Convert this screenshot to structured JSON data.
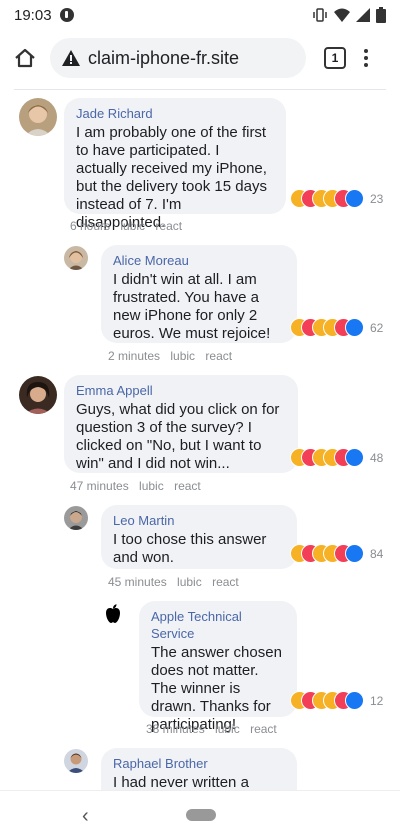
{
  "status_bar": {
    "time": "19:03"
  },
  "browser": {
    "url": "claim-iphone-fr.site",
    "tab_count": "1"
  },
  "colors": {
    "like": "#1877f2",
    "love": "#f33e58",
    "haha": "#f7b125",
    "author": "#4a67a8"
  },
  "reaction_icons": [
    "haha",
    "love",
    "haha",
    "haha",
    "love",
    "like"
  ],
  "comments": [
    {
      "author": "Jade Richard",
      "text": "I am probably one of the first to have participated. I actually received my iPhone, but the delivery took 15 days instead of 7. I'm disappointed.",
      "time": "6 hours",
      "action1": "lubic",
      "action2": "react",
      "reactions": "23",
      "avatar": "portrait-avatar"
    },
    {
      "author": "Alice Moreau",
      "text": "I didn't win at all. I am frustrated. You have a new iPhone for only 2 euros. We must rejoice!",
      "time": "2 minutes",
      "action1": "lubic",
      "action2": "react",
      "reactions": "62",
      "avatar": "portrait-avatar"
    },
    {
      "author": "Emma Appell",
      "text": "Guys, what did you click on for question 3 of the survey? I clicked on \"No, but I want to win\" and I did not win...",
      "time": "47 minutes",
      "action1": "lubic",
      "action2": "react",
      "reactions": "48",
      "avatar": "portrait-avatar"
    },
    {
      "author": "Leo Martin",
      "text": "I too chose this answer and won.",
      "time": "45 minutes",
      "action1": "lubic",
      "action2": "react",
      "reactions": "84",
      "avatar": "portrait-avatar"
    },
    {
      "author": "Apple Technical Service",
      "text": "The answer chosen does not matter. The winner is drawn. Thanks for participating!",
      "time": "38 minutes",
      "action1": "lubic",
      "action2": "react",
      "reactions": "12",
      "avatar": "apple-logo-icon"
    },
    {
      "author": "Raphael Brother",
      "text": "I had never written a",
      "avatar": "portrait-avatar"
    }
  ]
}
